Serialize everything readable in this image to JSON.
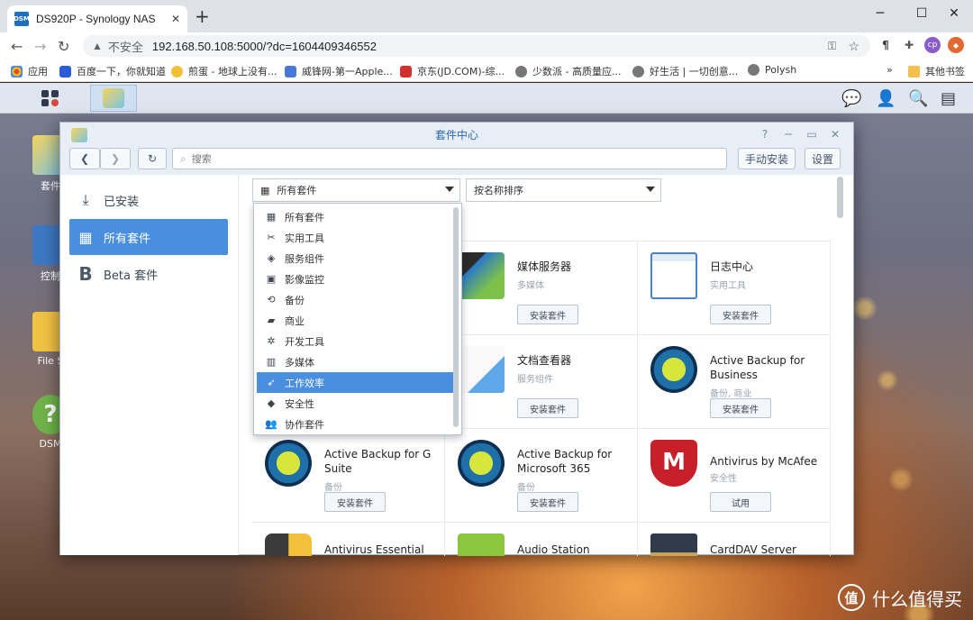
{
  "browser": {
    "tab_title": "DS920P - Synology NAS",
    "favicon_text": "DSM",
    "new_tab": "+",
    "insecure_label": "不安全",
    "url": "192.168.50.108:5000/?dc=1604409346552",
    "extensions": [
      "¶",
      "cp"
    ],
    "bookmarks": [
      {
        "label": "应用",
        "color": "#ff8c00"
      },
      {
        "label": "百度一下，你就知道",
        "color": "#2a5cd7"
      },
      {
        "label": "煎蛋 - 地球上没有...",
        "color": "#f2c037"
      },
      {
        "label": "威锋网-第一Apple...",
        "color": "#4a78d8"
      },
      {
        "label": "京东(JD.COM)-综...",
        "color": "#d0312d"
      },
      {
        "label": "少数派 - 高质量应...",
        "color": "#666666"
      },
      {
        "label": "好生活 | 一切创意...",
        "color": "#666666"
      },
      {
        "label": "Polysh",
        "color": "#666666"
      }
    ],
    "bookmarks_more": "»",
    "other_bookmarks": "其他书签"
  },
  "desktop_icons": [
    {
      "label": "套件"
    },
    {
      "label": "控制"
    },
    {
      "label": "File S"
    },
    {
      "label": "DSM"
    }
  ],
  "window": {
    "title": "套件中心",
    "search_placeholder": "搜索",
    "manual_install": "手动安装",
    "settings": "设置",
    "sidebar": [
      {
        "label": "已安装"
      },
      {
        "label": "所有套件",
        "active": true
      },
      {
        "label": "Beta 套件"
      }
    ],
    "filter_selected": "所有套件",
    "sort_selected": "按名称排序",
    "dropdown": [
      {
        "label": "所有套件",
        "icon": "grid-icon"
      },
      {
        "label": "实用工具",
        "icon": "tools-icon"
      },
      {
        "label": "服务组件",
        "icon": "cube-icon"
      },
      {
        "label": "影像监控",
        "icon": "camera-icon"
      },
      {
        "label": "备份",
        "icon": "backup-icon"
      },
      {
        "label": "商业",
        "icon": "briefcase-icon"
      },
      {
        "label": "开发工具",
        "icon": "dev-icon"
      },
      {
        "label": "多媒体",
        "icon": "film-icon"
      },
      {
        "label": "工作效率",
        "icon": "rocket-icon",
        "highlighted": true
      },
      {
        "label": "安全性",
        "icon": "shield-icon"
      },
      {
        "label": "协作套件",
        "icon": "people-icon"
      }
    ],
    "packages": [
      {
        "name": "媒体服务器",
        "category": "多媒体",
        "button": "安装套件"
      },
      {
        "name": "日志中心",
        "category": "实用工具",
        "button": "安装套件"
      },
      {
        "name": "文档查看器",
        "category": "服务组件",
        "button": "安装套件"
      },
      {
        "name": "Active Backup for Business",
        "category": "备份, 商业",
        "button": "安装套件"
      },
      {
        "name": "Active Backup for G Suite",
        "category": "备份",
        "button": "安装套件"
      },
      {
        "name": "Active Backup for Microsoft 365",
        "category": "备份",
        "button": "安装套件"
      },
      {
        "name": "Antivirus by McAfee",
        "category": "安全性",
        "button": "试用"
      },
      {
        "name": "Antivirus Essential",
        "category": "",
        "button": ""
      },
      {
        "name": "Audio Station",
        "category": "",
        "button": ""
      },
      {
        "name": "CardDAV Server",
        "category": "",
        "button": ""
      }
    ]
  },
  "watermark": "什么值得买",
  "watermark_logo": "值"
}
